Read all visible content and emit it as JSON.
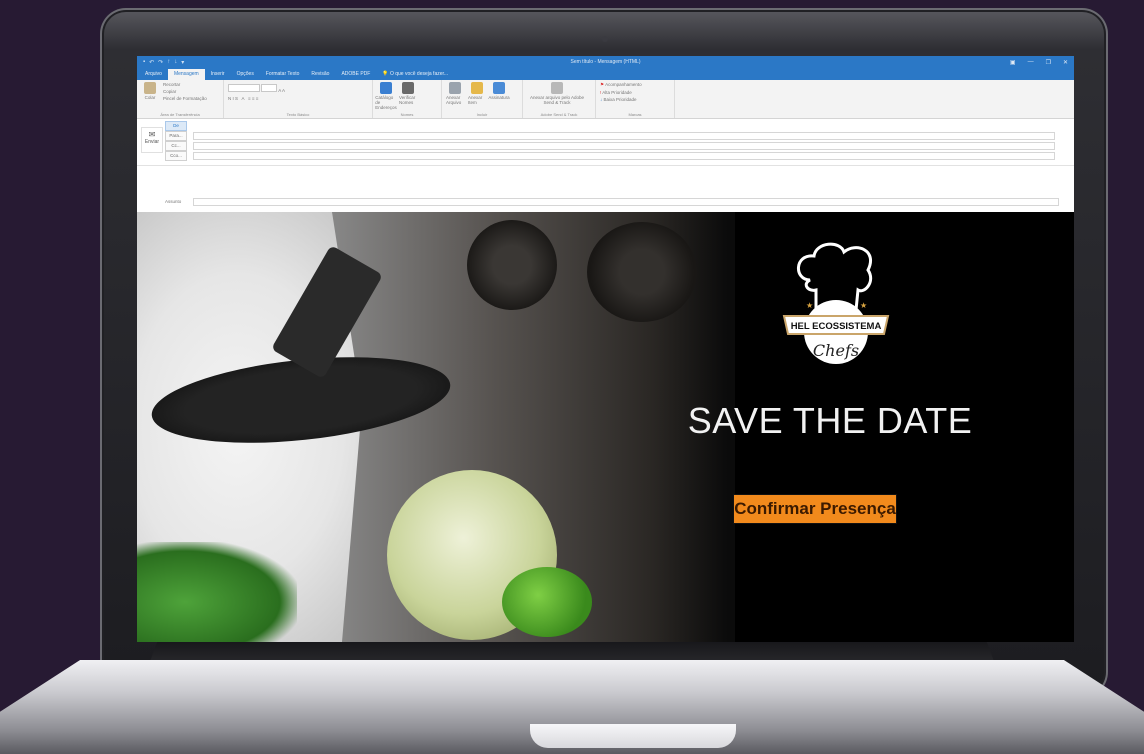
{
  "window": {
    "title": "Sem título - Mensagem (HTML)",
    "quick_access": [
      "▪",
      "↶",
      "↷",
      "↑",
      "↓",
      "▾"
    ],
    "controls": [
      "▣",
      "—",
      "❐",
      "✕"
    ]
  },
  "tabs": [
    {
      "label": "Arquivo"
    },
    {
      "label": "Mensagem"
    },
    {
      "label": "Inserir"
    },
    {
      "label": "Opções"
    },
    {
      "label": "Formatar Texto"
    },
    {
      "label": "Revisão"
    },
    {
      "label": "ADOBE PDF"
    }
  ],
  "tell_me": "O que você deseja fazer...",
  "ribbon": {
    "clipboard": {
      "paste": "Colar",
      "cut": "Recortar",
      "copy": "Copiar",
      "format_painter": "Pincel de Formatação",
      "label": "Área de Transferência"
    },
    "basic_text": {
      "label": "Texto Básico"
    },
    "names": {
      "address_book": "Catálogo de Endereços",
      "check_names": "Verificar Nomes",
      "label": "Nomes"
    },
    "include": {
      "attach_file": "Anexar Arquivo",
      "attach_item": "Anexar Item",
      "signature": "Assinatura",
      "label": "Incluir"
    },
    "adobe": {
      "attach_file": "Anexar arquivo pelo Adobe Send & Track",
      "label": "Adobe Send & Track"
    },
    "tags": {
      "follow_up": "Acompanhamento",
      "high": "Alta Prioridade",
      "low": "Baixa Prioridade",
      "label": "Marcas"
    }
  },
  "compose": {
    "send": "Enviar",
    "from": "De",
    "to": "Para...",
    "cc": "Cc...",
    "bcc": "Cco...",
    "subject": "Assunto"
  },
  "email": {
    "logo_text": "HEL ECOSSISTEMA",
    "logo_script": "Chefs",
    "headline": "SAVE THE DATE",
    "cta": "Confirmar Presença"
  },
  "colors": {
    "outlook_blue": "#2b78c6",
    "cta_orange": "#f28a1c",
    "background": "#271a33"
  }
}
